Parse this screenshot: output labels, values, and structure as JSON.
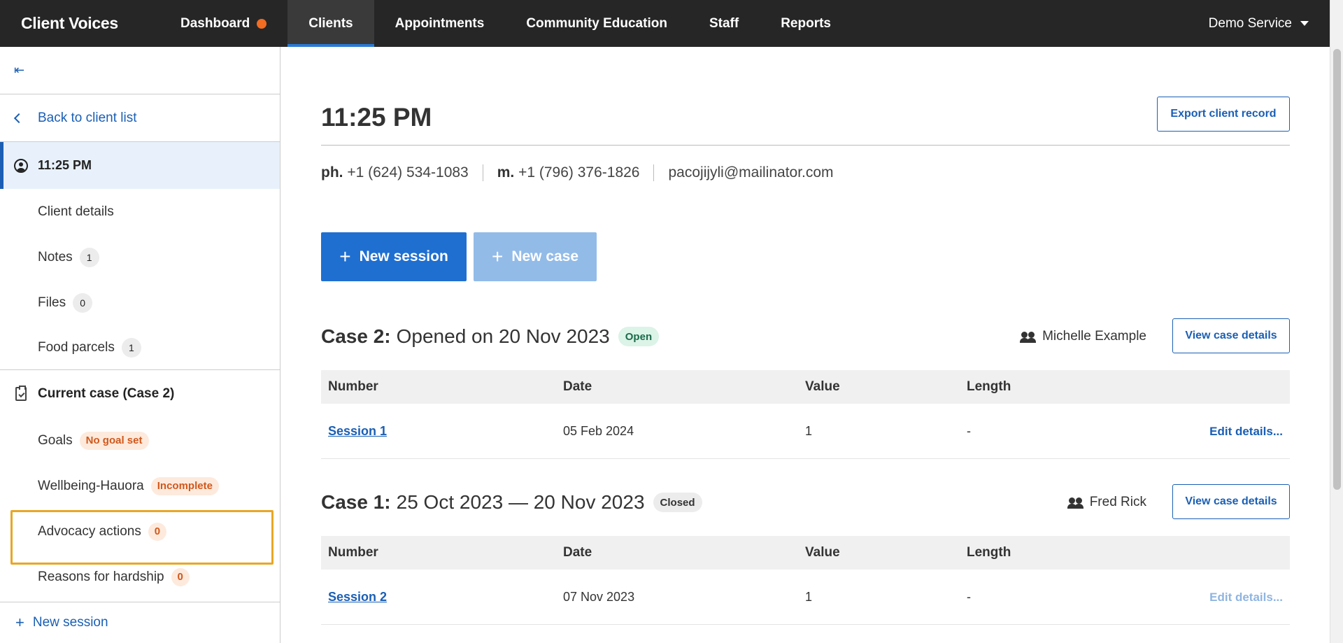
{
  "app": {
    "brand": "Client Voices",
    "account": "Demo Service"
  },
  "nav": {
    "dashboard": "Dashboard",
    "clients": "Clients",
    "appointments": "Appointments",
    "community_education": "Community Education",
    "staff": "Staff",
    "reports": "Reports"
  },
  "sidebar": {
    "collapse_icon": "collapse-left-icon",
    "back": "Back to client list",
    "client_name": "11:25 PM",
    "client_details": "Client details",
    "notes": {
      "label": "Notes",
      "count": "1"
    },
    "files": {
      "label": "Files",
      "count": "0"
    },
    "food_parcels": {
      "label": "Food parcels",
      "count": "1"
    },
    "current_case": "Current case (Case 2)",
    "goals": {
      "label": "Goals",
      "badge": "No goal set"
    },
    "wellbeing": {
      "label": "Wellbeing-Hauora",
      "badge": "Incomplete"
    },
    "advocacy": {
      "label": "Advocacy actions",
      "count": "0"
    },
    "hardship": {
      "label": "Reasons for hardship",
      "count": "0"
    },
    "new_session": "New session"
  },
  "main": {
    "title": "11:25 PM",
    "export_button": "Export client record",
    "phone_label": "ph.",
    "phone": "+1 (624) 534-1083",
    "mobile_label": "m.",
    "mobile": "+1 (796) 376-1826",
    "email": "pacojijyli@mailinator.com",
    "new_session_button": "New session",
    "new_case_button": "New case"
  },
  "cases": [
    {
      "label": "Case 2:",
      "title": "Opened on 20 Nov 2023",
      "status": "Open",
      "worker": "Michelle Example",
      "view_button": "View case details",
      "columns": [
        "Number",
        "Date",
        "Value",
        "Length"
      ],
      "rows": [
        {
          "number": "Session 1",
          "date": "05 Feb 2024",
          "value": "1",
          "length": "-",
          "edit": "Edit details..."
        }
      ]
    },
    {
      "label": "Case 1:",
      "title": "25 Oct 2023 — 20 Nov 2023",
      "status": "Closed",
      "worker": "Fred Rick",
      "view_button": "View case details",
      "columns": [
        "Number",
        "Date",
        "Value",
        "Length"
      ],
      "rows": [
        {
          "number": "Session 2",
          "date": "07 Nov 2023",
          "value": "1",
          "length": "-",
          "edit": "Edit details..."
        }
      ]
    }
  ]
}
